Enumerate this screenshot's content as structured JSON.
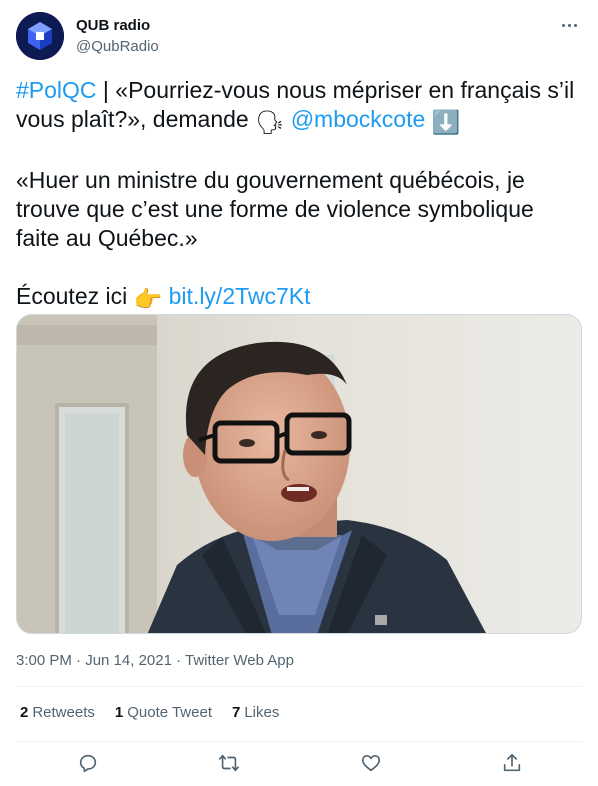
{
  "account": {
    "name": "QUB radio",
    "handle": "@QubRadio",
    "avatar_color": "#0e1a52"
  },
  "tweet": {
    "hashtag": "#PolQC",
    "line1_rest": " | «Pourriez-vous nous mépriser en français s’il vous plaît?», demande ",
    "emoji_speaking": "🗣",
    "mention": "@mbockcote",
    "emoji_down": "⬇️",
    "quote": "«Huer un ministre du gouvernement québécois, je trouve que c’est une forme de violence symbolique faite au Québec.»",
    "listen_text": "Écoutez ici ",
    "emoji_point": "👉",
    "short_link": "bit.ly/2Twc7Kt"
  },
  "meta": {
    "time": "3:00 PM · Jun 14, 2021 · ",
    "source": "Twitter Web App"
  },
  "stats": {
    "retweets_count": "2",
    "retweets_label": "Retweets",
    "quotes_count": "1",
    "quotes_label": "Quote Tweet",
    "likes_count": "7",
    "likes_label": "Likes"
  },
  "actions": [
    "reply-icon",
    "retweet-icon",
    "like-icon",
    "share-icon"
  ],
  "colors": {
    "link": "#1d9bf0",
    "secondary_text": "#536471",
    "primary_text": "#0f1419"
  }
}
